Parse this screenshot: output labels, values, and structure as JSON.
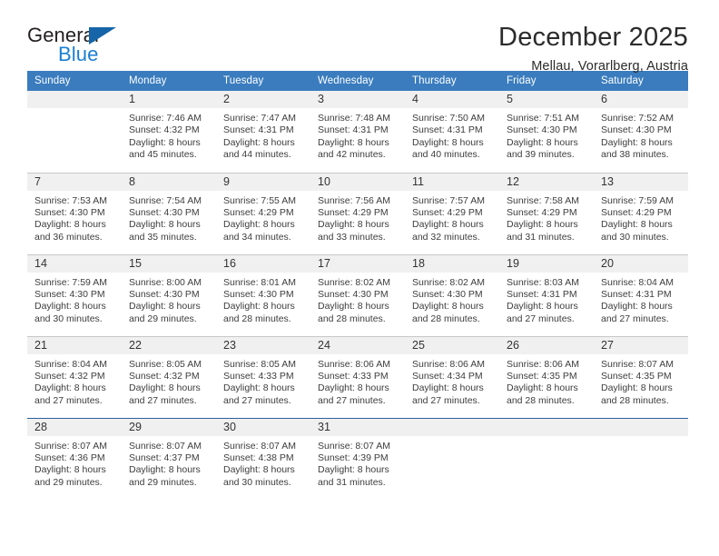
{
  "logo": {
    "word_top": "General",
    "word_bottom": "Blue",
    "triangle_icon": "blue-triangle-icon",
    "color_dark": "#231f20",
    "color_blue": "#1a7fd4",
    "color_triangle": "#1565a8"
  },
  "header": {
    "title": "December 2025",
    "subtitle": "Mellau, Vorarlberg, Austria"
  },
  "theme": {
    "header_bg": "#3a7cbe",
    "daynum_bg": "#f0f0f0",
    "row_rule": "#c8c8c8",
    "last_row_rule": "#2a6099"
  },
  "columns": [
    "Sunday",
    "Monday",
    "Tuesday",
    "Wednesday",
    "Thursday",
    "Friday",
    "Saturday"
  ],
  "labels": {
    "sunrise_prefix": "Sunrise: ",
    "sunset_prefix": "Sunset: ",
    "daylight_prefix": "Daylight: "
  },
  "weeks": [
    [
      {
        "day": "",
        "empty": true
      },
      {
        "day": "1",
        "sunrise": "Sunrise: 7:46 AM",
        "sunset": "Sunset: 4:32 PM",
        "daylight1": "Daylight: 8 hours",
        "daylight2": "and 45 minutes."
      },
      {
        "day": "2",
        "sunrise": "Sunrise: 7:47 AM",
        "sunset": "Sunset: 4:31 PM",
        "daylight1": "Daylight: 8 hours",
        "daylight2": "and 44 minutes."
      },
      {
        "day": "3",
        "sunrise": "Sunrise: 7:48 AM",
        "sunset": "Sunset: 4:31 PM",
        "daylight1": "Daylight: 8 hours",
        "daylight2": "and 42 minutes."
      },
      {
        "day": "4",
        "sunrise": "Sunrise: 7:50 AM",
        "sunset": "Sunset: 4:31 PM",
        "daylight1": "Daylight: 8 hours",
        "daylight2": "and 40 minutes."
      },
      {
        "day": "5",
        "sunrise": "Sunrise: 7:51 AM",
        "sunset": "Sunset: 4:30 PM",
        "daylight1": "Daylight: 8 hours",
        "daylight2": "and 39 minutes."
      },
      {
        "day": "6",
        "sunrise": "Sunrise: 7:52 AM",
        "sunset": "Sunset: 4:30 PM",
        "daylight1": "Daylight: 8 hours",
        "daylight2": "and 38 minutes."
      }
    ],
    [
      {
        "day": "7",
        "sunrise": "Sunrise: 7:53 AM",
        "sunset": "Sunset: 4:30 PM",
        "daylight1": "Daylight: 8 hours",
        "daylight2": "and 36 minutes."
      },
      {
        "day": "8",
        "sunrise": "Sunrise: 7:54 AM",
        "sunset": "Sunset: 4:30 PM",
        "daylight1": "Daylight: 8 hours",
        "daylight2": "and 35 minutes."
      },
      {
        "day": "9",
        "sunrise": "Sunrise: 7:55 AM",
        "sunset": "Sunset: 4:29 PM",
        "daylight1": "Daylight: 8 hours",
        "daylight2": "and 34 minutes."
      },
      {
        "day": "10",
        "sunrise": "Sunrise: 7:56 AM",
        "sunset": "Sunset: 4:29 PM",
        "daylight1": "Daylight: 8 hours",
        "daylight2": "and 33 minutes."
      },
      {
        "day": "11",
        "sunrise": "Sunrise: 7:57 AM",
        "sunset": "Sunset: 4:29 PM",
        "daylight1": "Daylight: 8 hours",
        "daylight2": "and 32 minutes."
      },
      {
        "day": "12",
        "sunrise": "Sunrise: 7:58 AM",
        "sunset": "Sunset: 4:29 PM",
        "daylight1": "Daylight: 8 hours",
        "daylight2": "and 31 minutes."
      },
      {
        "day": "13",
        "sunrise": "Sunrise: 7:59 AM",
        "sunset": "Sunset: 4:29 PM",
        "daylight1": "Daylight: 8 hours",
        "daylight2": "and 30 minutes."
      }
    ],
    [
      {
        "day": "14",
        "sunrise": "Sunrise: 7:59 AM",
        "sunset": "Sunset: 4:30 PM",
        "daylight1": "Daylight: 8 hours",
        "daylight2": "and 30 minutes."
      },
      {
        "day": "15",
        "sunrise": "Sunrise: 8:00 AM",
        "sunset": "Sunset: 4:30 PM",
        "daylight1": "Daylight: 8 hours",
        "daylight2": "and 29 minutes."
      },
      {
        "day": "16",
        "sunrise": "Sunrise: 8:01 AM",
        "sunset": "Sunset: 4:30 PM",
        "daylight1": "Daylight: 8 hours",
        "daylight2": "and 28 minutes."
      },
      {
        "day": "17",
        "sunrise": "Sunrise: 8:02 AM",
        "sunset": "Sunset: 4:30 PM",
        "daylight1": "Daylight: 8 hours",
        "daylight2": "and 28 minutes."
      },
      {
        "day": "18",
        "sunrise": "Sunrise: 8:02 AM",
        "sunset": "Sunset: 4:30 PM",
        "daylight1": "Daylight: 8 hours",
        "daylight2": "and 28 minutes."
      },
      {
        "day": "19",
        "sunrise": "Sunrise: 8:03 AM",
        "sunset": "Sunset: 4:31 PM",
        "daylight1": "Daylight: 8 hours",
        "daylight2": "and 27 minutes."
      },
      {
        "day": "20",
        "sunrise": "Sunrise: 8:04 AM",
        "sunset": "Sunset: 4:31 PM",
        "daylight1": "Daylight: 8 hours",
        "daylight2": "and 27 minutes."
      }
    ],
    [
      {
        "day": "21",
        "sunrise": "Sunrise: 8:04 AM",
        "sunset": "Sunset: 4:32 PM",
        "daylight1": "Daylight: 8 hours",
        "daylight2": "and 27 minutes."
      },
      {
        "day": "22",
        "sunrise": "Sunrise: 8:05 AM",
        "sunset": "Sunset: 4:32 PM",
        "daylight1": "Daylight: 8 hours",
        "daylight2": "and 27 minutes."
      },
      {
        "day": "23",
        "sunrise": "Sunrise: 8:05 AM",
        "sunset": "Sunset: 4:33 PM",
        "daylight1": "Daylight: 8 hours",
        "daylight2": "and 27 minutes."
      },
      {
        "day": "24",
        "sunrise": "Sunrise: 8:06 AM",
        "sunset": "Sunset: 4:33 PM",
        "daylight1": "Daylight: 8 hours",
        "daylight2": "and 27 minutes."
      },
      {
        "day": "25",
        "sunrise": "Sunrise: 8:06 AM",
        "sunset": "Sunset: 4:34 PM",
        "daylight1": "Daylight: 8 hours",
        "daylight2": "and 27 minutes."
      },
      {
        "day": "26",
        "sunrise": "Sunrise: 8:06 AM",
        "sunset": "Sunset: 4:35 PM",
        "daylight1": "Daylight: 8 hours",
        "daylight2": "and 28 minutes."
      },
      {
        "day": "27",
        "sunrise": "Sunrise: 8:07 AM",
        "sunset": "Sunset: 4:35 PM",
        "daylight1": "Daylight: 8 hours",
        "daylight2": "and 28 minutes."
      }
    ],
    [
      {
        "day": "28",
        "sunrise": "Sunrise: 8:07 AM",
        "sunset": "Sunset: 4:36 PM",
        "daylight1": "Daylight: 8 hours",
        "daylight2": "and 29 minutes."
      },
      {
        "day": "29",
        "sunrise": "Sunrise: 8:07 AM",
        "sunset": "Sunset: 4:37 PM",
        "daylight1": "Daylight: 8 hours",
        "daylight2": "and 29 minutes."
      },
      {
        "day": "30",
        "sunrise": "Sunrise: 8:07 AM",
        "sunset": "Sunset: 4:38 PM",
        "daylight1": "Daylight: 8 hours",
        "daylight2": "and 30 minutes."
      },
      {
        "day": "31",
        "sunrise": "Sunrise: 8:07 AM",
        "sunset": "Sunset: 4:39 PM",
        "daylight1": "Daylight: 8 hours",
        "daylight2": "and 31 minutes."
      },
      {
        "day": "",
        "empty": true
      },
      {
        "day": "",
        "empty": true
      },
      {
        "day": "",
        "empty": true
      }
    ]
  ]
}
